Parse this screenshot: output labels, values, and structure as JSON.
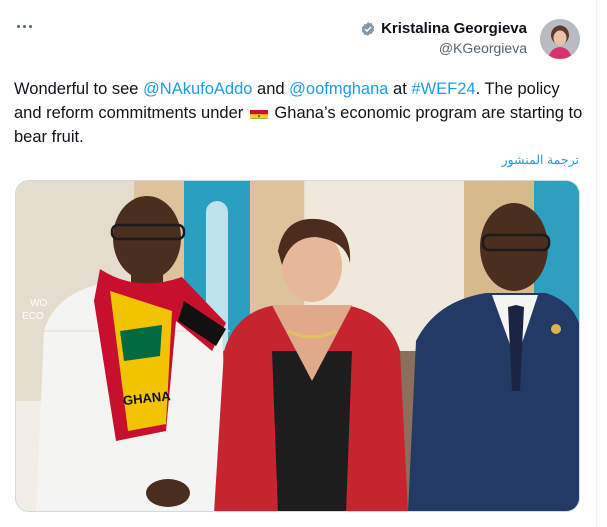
{
  "menu": {
    "icon": "more-dots-icon"
  },
  "author": {
    "display_name": "Kristalina Georgieva",
    "handle": "@KGeorgieva",
    "verified_icon": "verified-badge-icon"
  },
  "tweet": {
    "part1": "Wonderful to see ",
    "mention1": "@NAkufoAddo",
    "part2": " and ",
    "mention2": "@oofmghana",
    "part3": " at ",
    "hashtag": "#WEF24",
    "part4": ". The policy and reform commitments under ",
    "flag": "ghana-flag-emoji",
    "part5": " Ghana’s economic program are starting to bear fruit."
  },
  "translate": {
    "label": "ترجمة المنشور"
  },
  "media": {
    "scarf_text": "GHANA",
    "wall_text": "WO ECO FO"
  },
  "colors": {
    "link": "#1d9bf0",
    "text": "#0f1419",
    "muted": "#536471"
  }
}
